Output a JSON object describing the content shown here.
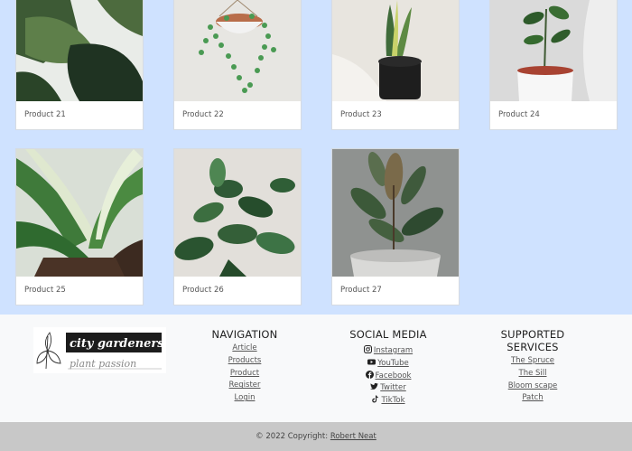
{
  "products": [
    {
      "label": "Product 21"
    },
    {
      "label": "Product 22"
    },
    {
      "label": "Product 23"
    },
    {
      "label": "Product 24"
    },
    {
      "label": "Product 25"
    },
    {
      "label": "Product 26"
    },
    {
      "label": "Product 27"
    }
  ],
  "footer": {
    "logo": {
      "line1": "city gardeners",
      "line2": "plant passion"
    },
    "navigation": {
      "heading": "NAVIGATION",
      "links": [
        "Article",
        "Products",
        "Product",
        "Register",
        "Login"
      ]
    },
    "social": {
      "heading": "SOCIAL MEDIA",
      "links": [
        {
          "label": "Instagram",
          "icon": "instagram-icon"
        },
        {
          "label": "YouTube",
          "icon": "youtube-icon"
        },
        {
          "label": "Facebook",
          "icon": "facebook-icon"
        },
        {
          "label": "Twitter",
          "icon": "twitter-icon"
        },
        {
          "label": "TikTok",
          "icon": "tiktok-icon"
        }
      ]
    },
    "services": {
      "heading": "SUPPORTED SERVICES",
      "links": [
        "The Spruce",
        "The Sill",
        "Bloom scape",
        "Patch"
      ]
    },
    "copyright": {
      "text": "© 2022 Copyright: ",
      "author": "Robert Neat"
    }
  },
  "colors": {
    "page_bg": "#cfe2ff",
    "footer_bg": "#f8f9fa",
    "copyright_bg": "#c8c8c8"
  }
}
